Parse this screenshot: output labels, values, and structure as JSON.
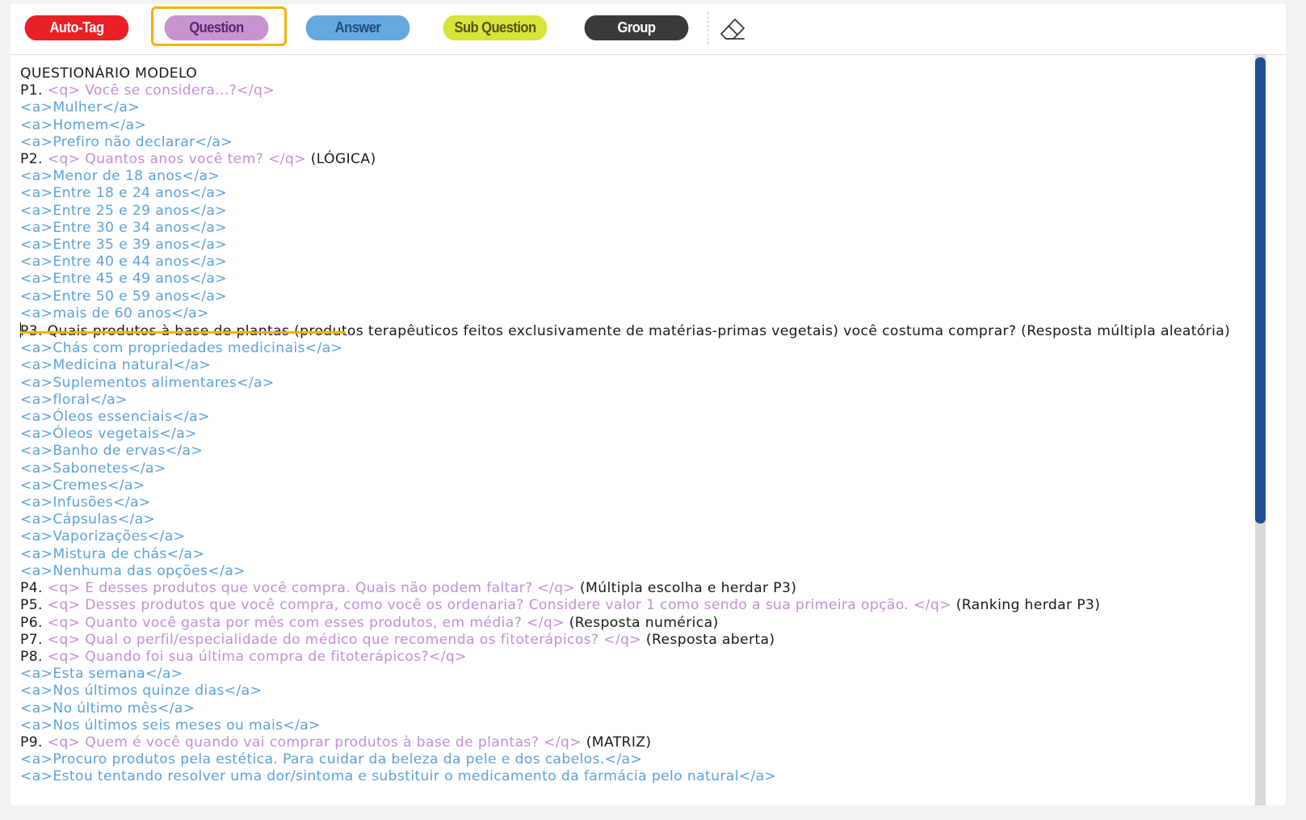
{
  "toolbar": {
    "buttons": [
      {
        "label": "Auto-Tag",
        "color": "#ea2027"
      },
      {
        "label": "Question",
        "color": "#c992d0",
        "selected": true
      },
      {
        "label": "Answer",
        "color": "#64a8e0"
      },
      {
        "label": "Sub Question",
        "color": "#d8e43a"
      },
      {
        "label": "Group",
        "color": "#3a3a3c"
      }
    ],
    "eraser_icon": "eraser-icon"
  },
  "colors": {
    "question_tag": "#c48fd3",
    "answer_tag": "#5ba3da",
    "selection_highlight": "#f4b400",
    "scrollbar": "#1f4f96"
  },
  "editor": {
    "lines": [
      [
        {
          "t": "QUESTIONÁRIO MODELO",
          "c": "p"
        }
      ],
      [
        {
          "t": "P1. ",
          "c": "p"
        },
        {
          "t": "<q> Você se considera...?</q>",
          "c": "q"
        }
      ],
      [
        {
          "t": "<a>Mulher</a>",
          "c": "a"
        }
      ],
      [
        {
          "t": "<a>Homem</a>",
          "c": "a"
        }
      ],
      [
        {
          "t": "<a>Prefiro não declarar</a>",
          "c": "a"
        }
      ],
      [
        {
          "t": "P2. ",
          "c": "p"
        },
        {
          "t": "<q> Quantos anos você tem? </q>",
          "c": "q"
        },
        {
          "t": " (LÓGICA)",
          "c": "p"
        }
      ],
      [
        {
          "t": "<a>Menor de 18 anos</a>",
          "c": "a"
        }
      ],
      [
        {
          "t": "<a>Entre 18 e 24 anos</a>",
          "c": "a"
        }
      ],
      [
        {
          "t": "<a>Entre 25 e 29 anos</a>",
          "c": "a"
        }
      ],
      [
        {
          "t": "<a>Entre 30 e 34 anos</a>",
          "c": "a"
        }
      ],
      [
        {
          "t": "<a>Entre 35 e 39 anos</a>",
          "c": "a"
        }
      ],
      [
        {
          "t": "<a>Entre 40 e 44 anos</a>",
          "c": "a"
        }
      ],
      [
        {
          "t": "<a>Entre 45 e 49 anos</a>",
          "c": "a"
        }
      ],
      [
        {
          "t": "<a>Entre 50 e 59 anos</a>",
          "c": "a"
        }
      ],
      [
        {
          "t": "<a>mais de 60 anos</a>",
          "c": "a"
        }
      ],
      [
        {
          "t": "P3. Quais produtos à base de plantas (produtos terapêuticos feitos exclusivamente de matérias-primas vegetais) você costuma comprar? (Resposta múltipla aleatória)",
          "c": "p",
          "caret": true
        }
      ],
      [
        {
          "t": "<a>Chás com propriedades medicinais</a>",
          "c": "a"
        }
      ],
      [
        {
          "t": "<a>Medicina natural</a>",
          "c": "a"
        }
      ],
      [
        {
          "t": "<a>Suplementos alimentares</a>",
          "c": "a"
        }
      ],
      [
        {
          "t": "<a>floral</a>",
          "c": "a"
        }
      ],
      [
        {
          "t": "<a>Óleos essenciais</a>",
          "c": "a"
        }
      ],
      [
        {
          "t": "<a>Óleos vegetais</a>",
          "c": "a"
        }
      ],
      [
        {
          "t": "<a>Banho de ervas</a>",
          "c": "a"
        }
      ],
      [
        {
          "t": "<a>Sabonetes</a>",
          "c": "a"
        }
      ],
      [
        {
          "t": "<a>Cremes</a>",
          "c": "a"
        }
      ],
      [
        {
          "t": "<a>Infusões</a>",
          "c": "a"
        }
      ],
      [
        {
          "t": "<a>Cápsulas</a>",
          "c": "a"
        }
      ],
      [
        {
          "t": "<a>Vaporizações</a>",
          "c": "a"
        }
      ],
      [
        {
          "t": "<a>Mistura de chás</a>",
          "c": "a"
        }
      ],
      [
        {
          "t": "<a>Nenhuma das opções</a>",
          "c": "a"
        }
      ],
      [
        {
          "t": "P4. ",
          "c": "p"
        },
        {
          "t": "<q> E desses produtos que você compra. Quais não podem faltar? </q>",
          "c": "q"
        },
        {
          "t": " (Múltipla escolha e herdar P3)",
          "c": "p"
        }
      ],
      [
        {
          "t": "P5. ",
          "c": "p"
        },
        {
          "t": "<q> Desses produtos que você compra, como você os ordenaria? Considere valor 1 como sendo a sua primeira opção. </q>",
          "c": "q"
        },
        {
          "t": " (Ranking herdar P3)",
          "c": "p"
        }
      ],
      [
        {
          "t": "P6. ",
          "c": "p"
        },
        {
          "t": "<q> Quanto você gasta por mês com esses produtos, em média? </q>",
          "c": "q"
        },
        {
          "t": " (Resposta numérica)",
          "c": "p"
        }
      ],
      [
        {
          "t": "P7. ",
          "c": "p"
        },
        {
          "t": "<q> Qual o perfil/especialidade do médico que recomenda os fitoterápicos? </q>",
          "c": "q"
        },
        {
          "t": " (Resposta aberta)",
          "c": "p"
        }
      ],
      [
        {
          "t": "P8. ",
          "c": "p"
        },
        {
          "t": "<q> Quando foi sua última compra de fitoterápicos?</q>",
          "c": "q"
        }
      ],
      [
        {
          "t": "<a>Esta semana</a>",
          "c": "a"
        }
      ],
      [
        {
          "t": "<a>Nos últimos quinze dias</a>",
          "c": "a"
        }
      ],
      [
        {
          "t": "<a>No último mês</a>",
          "c": "a"
        }
      ],
      [
        {
          "t": "<a>Nos últimos seis meses ou mais</a>",
          "c": "a"
        }
      ],
      [
        {
          "t": "P9. ",
          "c": "p"
        },
        {
          "t": "<q> Quem é você quando vai comprar produtos à base de plantas? </q>",
          "c": "q"
        },
        {
          "t": " (MATRIZ)",
          "c": "p"
        }
      ],
      [
        {
          "t": "<a>Procuro produtos pela estética. Para cuidar da beleza da pele e dos cabelos.</a>",
          "c": "a"
        }
      ],
      [
        {
          "t": "<a>Estou tentando resolver uma dor/sintoma e substituir o medicamento da farmácia pelo natural</a>",
          "c": "a"
        }
      ]
    ]
  }
}
